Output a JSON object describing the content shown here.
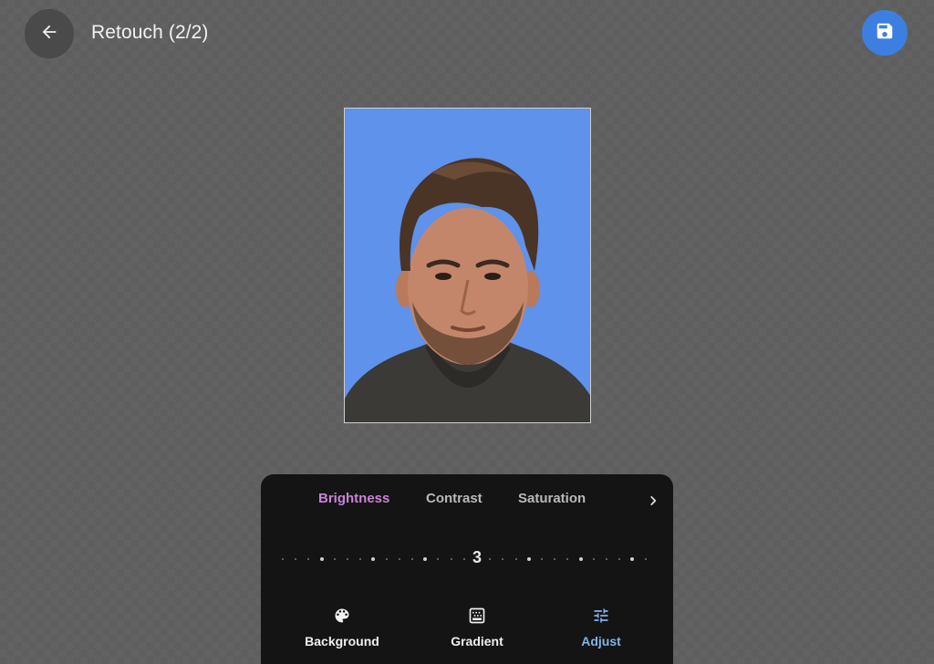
{
  "header": {
    "title": "Retouch (2/2)",
    "back_icon": "arrow-left-icon",
    "save_icon": "floppy-disk-icon"
  },
  "photo": {
    "background_color": "#5e92eb"
  },
  "adjust_tabs": [
    {
      "label": "Brightness",
      "active": true
    },
    {
      "label": "Contrast",
      "active": false
    },
    {
      "label": "Saturation",
      "active": false
    }
  ],
  "slider": {
    "value": "3"
  },
  "tools": [
    {
      "label": "Background",
      "icon": "palette-icon",
      "active": false
    },
    {
      "label": "Gradient",
      "icon": "gradient-icon",
      "active": false
    },
    {
      "label": "Adjust",
      "icon": "sliders-icon",
      "active": true
    }
  ],
  "colors": {
    "accent_blue": "#3d7fe0",
    "active_tab": "#c983d8",
    "active_tool": "#7fb4e8",
    "panel": "#141414"
  }
}
